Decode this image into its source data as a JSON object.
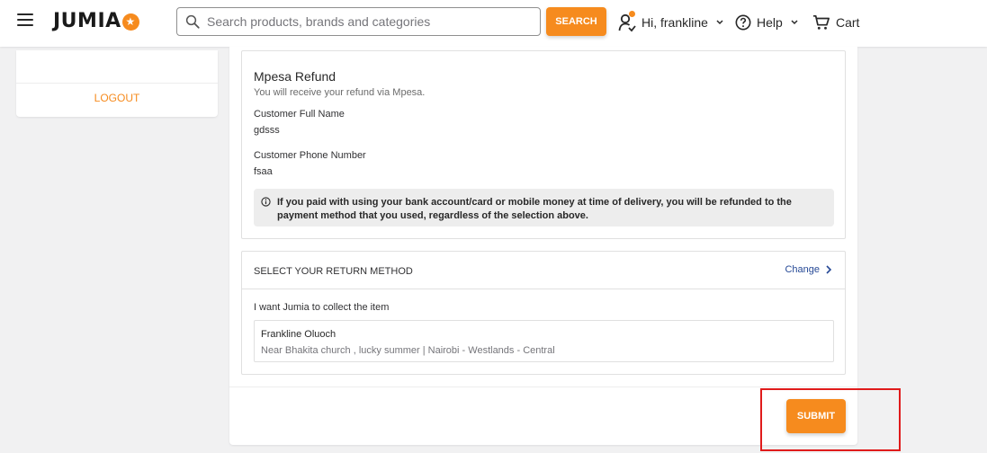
{
  "header": {
    "logo_text": "JUMIA",
    "search_placeholder": "Search products, brands and categories",
    "search_button": "SEARCH",
    "account_label": "Hi, frankline",
    "help_label": "Help",
    "cart_label": "Cart",
    "icons": [
      "menu-icon",
      "search-icon",
      "account-icon",
      "help-icon",
      "cart-icon",
      "chevron-down-icon"
    ]
  },
  "sidebar": {
    "logout_label": "LOGOUT"
  },
  "refund": {
    "title": "Mpesa Refund",
    "subtitle": "You will receive your refund via Mpesa.",
    "name_label": "Customer Full Name",
    "name_value": "gdsss",
    "phone_label": "Customer Phone Number",
    "phone_value": "fsaa",
    "info_text": "If you paid with using your bank account/card or mobile money at time of delivery, you will be refunded to the payment method that you used, regardless of the selection above."
  },
  "return_method": {
    "heading": "SELECT YOUR RETURN METHOD",
    "change_label": "Change",
    "option_text": "I want Jumia to collect the item",
    "address_name": "Frankline Oluoch",
    "address_line": "Near Bhakita church , lucky summer | Nairobi - Westlands - Central"
  },
  "actions": {
    "submit_label": "SUBMIT"
  },
  "colors": {
    "accent": "#f68b1e",
    "link": "#264996",
    "highlight": "#e01b1b"
  }
}
